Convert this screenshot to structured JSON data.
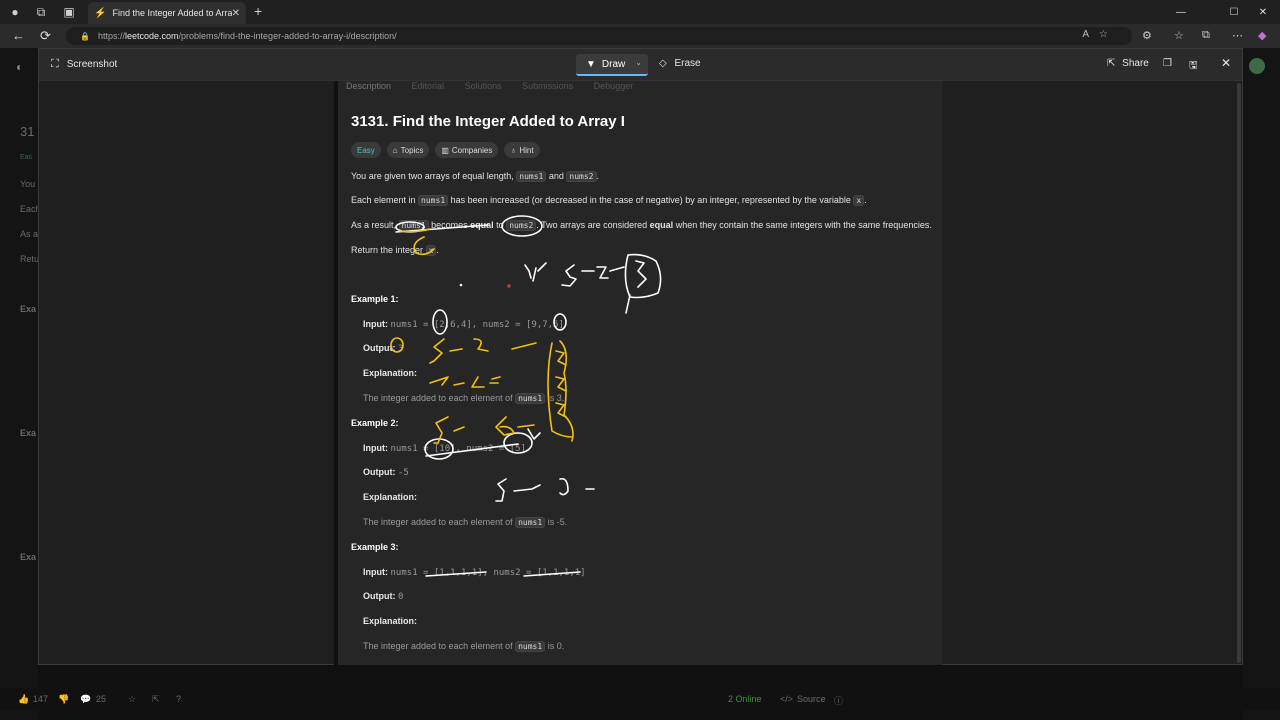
{
  "browser": {
    "tab_title": "Find the Integer Added to Array I",
    "url_host": "leetcode.com",
    "url_prefix": "https://",
    "url_path": "/problems/find-the-integer-added-to-array-i/description/"
  },
  "shot": {
    "title": "Screenshot",
    "draw_label": "Draw",
    "erase_label": "Erase",
    "share_label": "Share"
  },
  "problem": {
    "tabs": [
      "Description",
      "Editorial",
      "Solutions",
      "Submissions",
      "Debugger"
    ],
    "title": "3131. Find the Integer Added to Array I",
    "tags": {
      "difficulty": "Easy",
      "topics": "Topics",
      "companies": "Companies",
      "hint": "Hint"
    },
    "p1_a": "You are given two arrays of equal length, ",
    "p1_c1": "nums1",
    "p1_b": " and ",
    "p1_c2": "nums2",
    "p1_end": ".",
    "p2_a": "Each element in ",
    "p2_c1": "nums1",
    "p2_b": " has been increased (or decreased in the case of negative) by an integer, represented by the variable ",
    "p2_c2": "x",
    "p2_end": ".",
    "p3_a": "As a result, ",
    "p3_c1": "nums1",
    "p3_b": " becomes ",
    "p3_bold1": "equal",
    "p3_c": " to ",
    "p3_c2": "nums2",
    "p3_d": ". Two arrays are considered ",
    "p3_bold2": "equal",
    "p3_e": " when they contain the same integers with the same frequencies.",
    "p4_a": "Return the integer ",
    "p4_c1": "x",
    "p4_end": ".",
    "examples": [
      {
        "heading": "Example 1:",
        "input_label": "Input:",
        "input": "nums1 = [2,6,4], nums2 = [9,7,5]",
        "output_label": "Output:",
        "output": "3",
        "expl_label": "Explanation:",
        "expl_a": "The integer added to each element of ",
        "expl_code": "nums1",
        "expl_b": " is 3."
      },
      {
        "heading": "Example 2:",
        "input_label": "Input:",
        "input": "nums1 = [10], nums2 = [5]",
        "output_label": "Output:",
        "output": "-5",
        "expl_label": "Explanation:",
        "expl_a": "The integer added to each element of ",
        "expl_code": "nums1",
        "expl_b": " is -5."
      },
      {
        "heading": "Example 3:",
        "input_label": "Input:",
        "input": "nums1 = [1,1,1,1], nums2 = [1,1,1,1]",
        "output_label": "Output:",
        "output": "0",
        "expl_label": "Explanation:",
        "expl_a": "The integer added to each element of ",
        "expl_code": "nums1",
        "expl_b": " is 0."
      }
    ]
  },
  "backdrop": {
    "left_items": [
      "31",
      "Eas",
      "You",
      "Each",
      "As a",
      "Retu",
      "Exa",
      "Exa",
      "Exa"
    ],
    "likes": "147",
    "comments": "25",
    "online": "2 Online",
    "source": "Source"
  },
  "colors": {
    "ink_white": "#ffffff",
    "ink_yellow": "#f2c10f",
    "accent": "#6bb6ff",
    "easy": "#46c6c2"
  }
}
